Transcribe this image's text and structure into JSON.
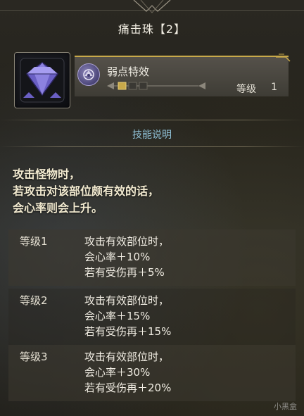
{
  "title": "痛击珠【2】",
  "skill": {
    "name": "弱点特效",
    "level_label": "等级",
    "level_value": "1",
    "max_level": 3,
    "current_level": 1
  },
  "section_title": "技能说明",
  "description": [
    "攻击怪物时，",
    "若攻击对该部位颇有效的话，",
    "会心率则会上升。"
  ],
  "levels": [
    {
      "name": "等级1",
      "lines": [
        "攻击有效部位时，",
        "会心率＋10%",
        "若有受伤再＋5%"
      ]
    },
    {
      "name": "等级2",
      "lines": [
        "攻击有效部位时，",
        "会心率＋15%",
        "若有受伤再＋15%"
      ]
    },
    {
      "name": "等级3",
      "lines": [
        "攻击有效部位时，",
        "会心率＋30%",
        "若有受伤再＋20%"
      ]
    }
  ],
  "watermark": "小黑盒",
  "colors": {
    "gold": "#c8a94a",
    "section_title": "#8fc0d6",
    "gem": "#7a6fd0"
  }
}
